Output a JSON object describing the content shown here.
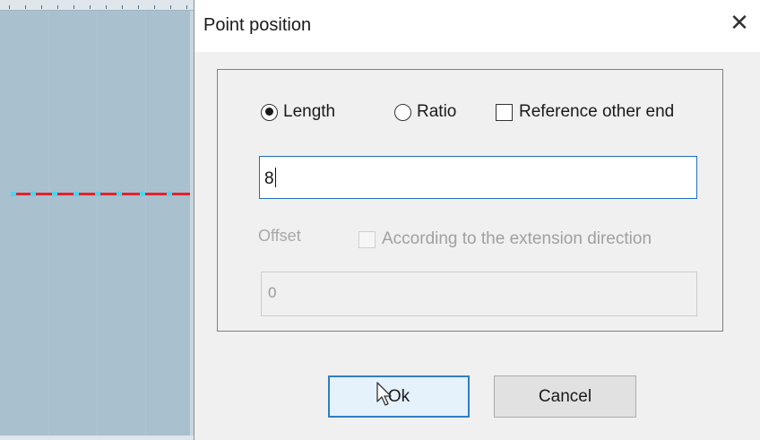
{
  "dialog": {
    "title": "Point position",
    "close_icon": "close-icon",
    "mode_options": [
      {
        "label": "Length",
        "type": "radio",
        "checked": true
      },
      {
        "label": "Ratio",
        "type": "radio",
        "checked": false
      }
    ],
    "reference_other_end": {
      "label": "Reference other end",
      "checked": false
    },
    "length_value": "8",
    "offset_label": "Offset",
    "extension_direction": {
      "label": "According to the extension direction",
      "checked": false,
      "enabled": false
    },
    "offset_value": "0",
    "ok_label": "Ok",
    "cancel_label": "Cancel"
  },
  "canvas": {
    "line_color": "#e8202a",
    "endpoint_color": "#4dd7ee",
    "background_color": "#a9c0ce"
  },
  "colors": {
    "accent": "#1e6fb8",
    "dialog_bg": "#f0f0f0"
  }
}
